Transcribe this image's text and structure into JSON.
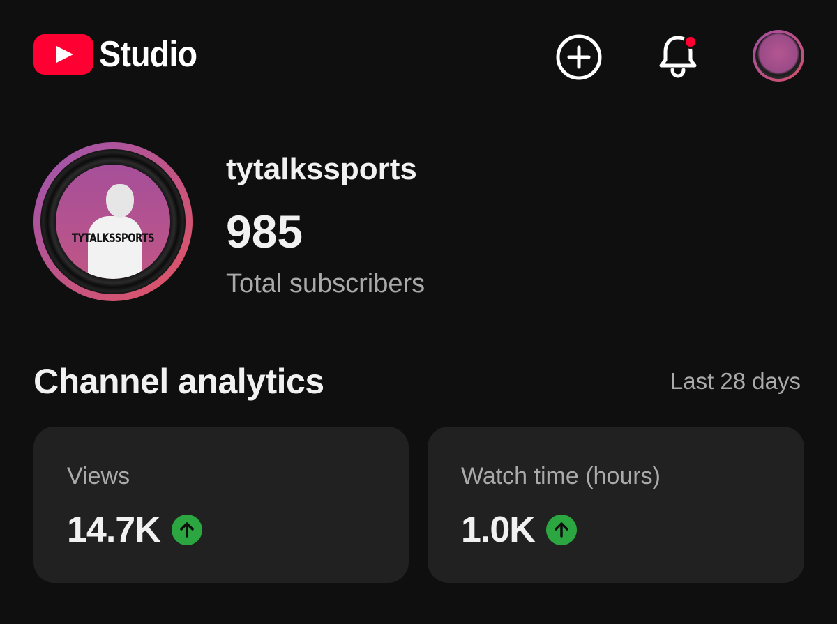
{
  "header": {
    "app_name": "Studio",
    "create_icon": "add-circle-icon",
    "notifications_icon": "bell-icon",
    "account_icon": "account-avatar",
    "brand_color": "#ff0033"
  },
  "channel": {
    "name": "tytalkssports",
    "avatar_text": "TYTALKSSPORTS",
    "subscriber_count": "985",
    "subscriber_label": "Total subscribers"
  },
  "analytics": {
    "title": "Channel analytics",
    "range": "Last 28 days",
    "cards": [
      {
        "label": "Views",
        "value": "14.7K",
        "trend": "up",
        "trend_color": "#2ba640"
      },
      {
        "label": "Watch time (hours)",
        "value": "1.0K",
        "trend": "up",
        "trend_color": "#2ba640"
      }
    ]
  }
}
